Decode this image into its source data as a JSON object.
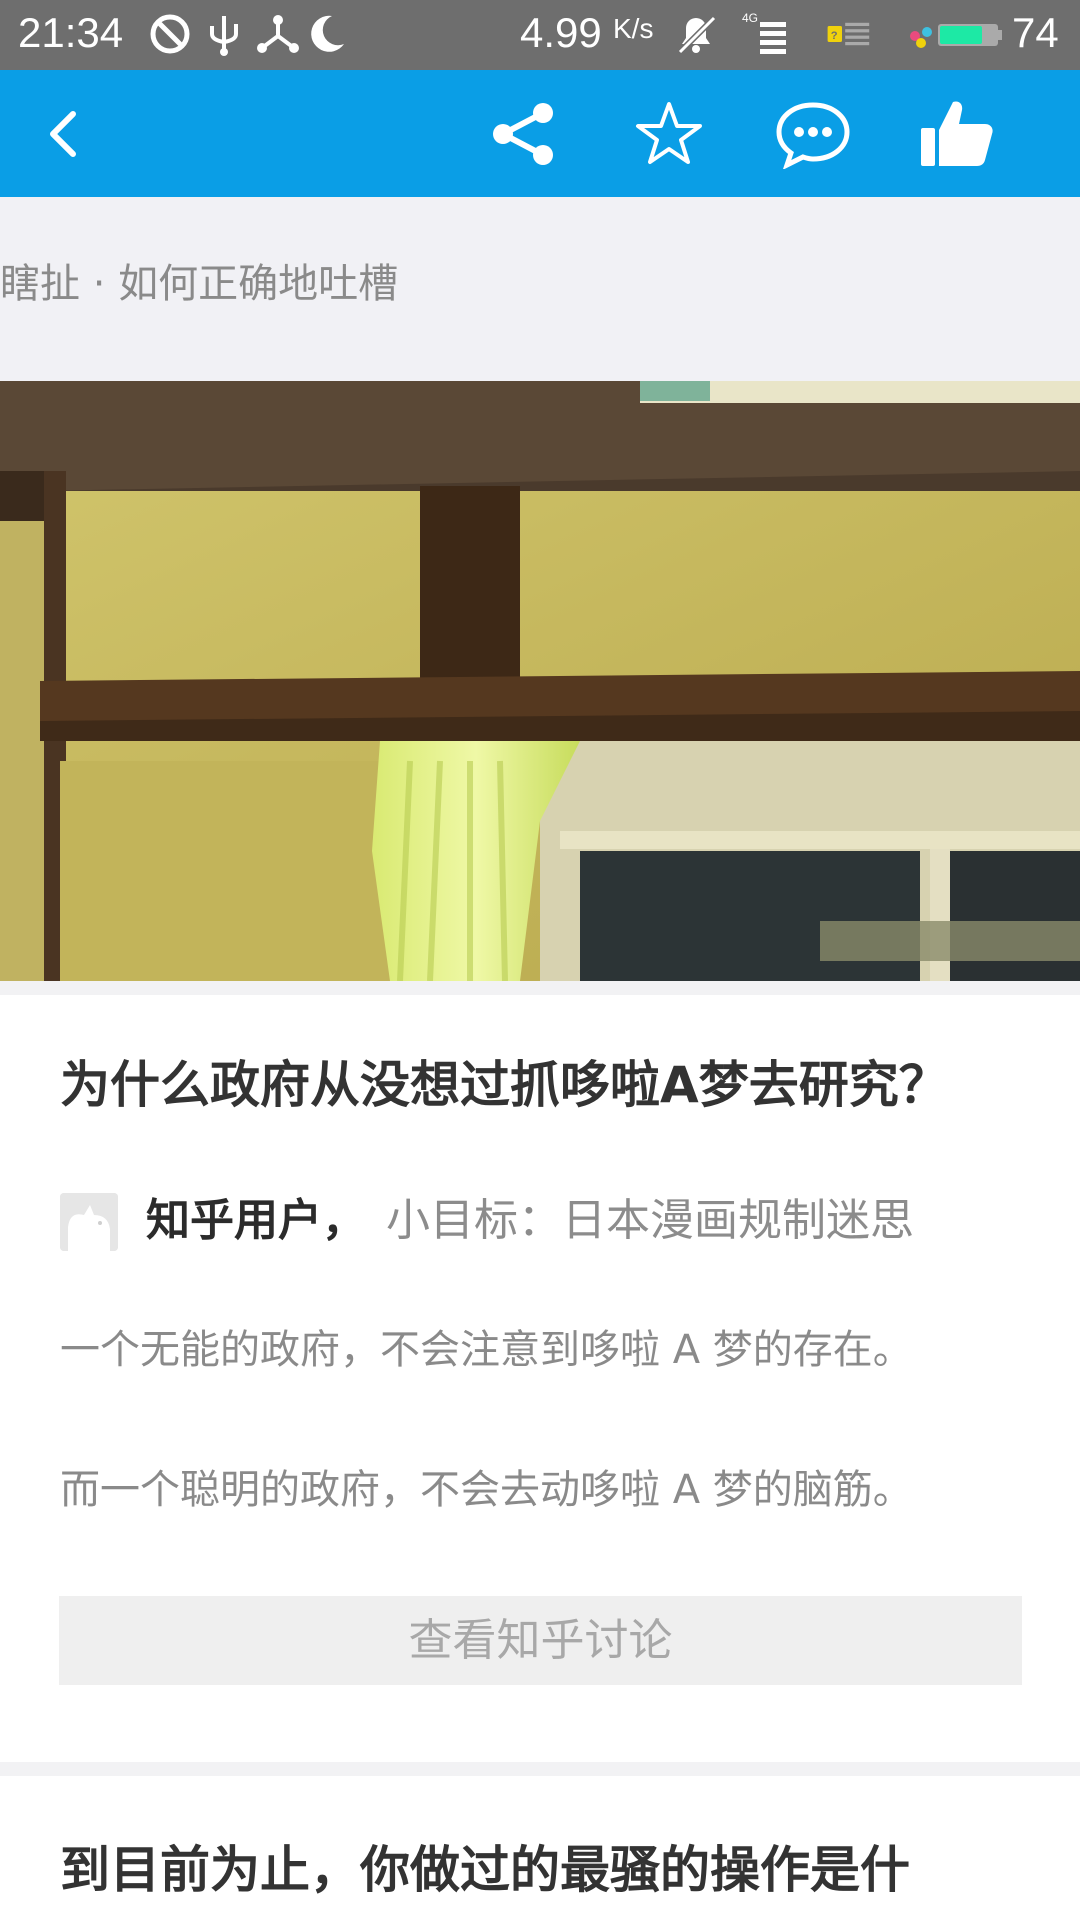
{
  "status_bar": {
    "time": "21:34",
    "net_speed": "4.99",
    "net_speed_unit": "K/s",
    "network_type": "4G",
    "battery_level": "74",
    "icons": [
      "do-not-disturb-icon",
      "usb-icon",
      "share-hub-icon",
      "moon-icon",
      "mute-icon",
      "signal-icon",
      "sim-icon",
      "battery-icon"
    ]
  },
  "toolbar": {
    "color": "#0a9ee6",
    "icons": [
      "back-icon",
      "share-icon",
      "star-icon",
      "comment-icon",
      "thumbs-up-icon"
    ]
  },
  "column": {
    "title": "瞎扯 · 如何正确地吐槽"
  },
  "answer1": {
    "question_title": "为什么政府从没想过抓哆啦A梦去研究？",
    "author_name": "知乎用户，",
    "author_bio": "小目标：日本漫画规制迷思",
    "paragraphs": [
      "一个无能的政府，不会注意到哆啦 A 梦的存在。",
      "而一个聪明的政府，不会去动哆啦 A 梦的脑筋。"
    ],
    "discuss_button": "查看知乎讨论"
  },
  "answer2": {
    "question_title": "到目前为止，你做过的最骚的操作是什"
  }
}
